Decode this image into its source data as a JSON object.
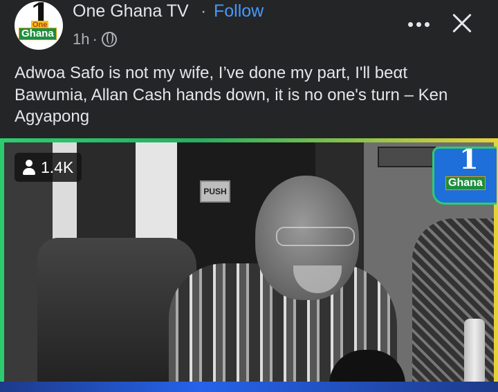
{
  "header": {
    "page_name": "One Ghana TV",
    "separator": "·",
    "follow_label": "Follow",
    "time": "1h",
    "meta_dot": "·",
    "avatar_logo": {
      "number": "1",
      "word1": "One",
      "word2": "Ghana"
    },
    "more_icon": "more-dots-icon",
    "close_icon": "close-icon",
    "privacy_icon": "globe-icon"
  },
  "post": {
    "caption": "Adwoa Safo is not my wife, I’ve done my part, I'll beαt Bawumia, Allan Cash hands down, it is no one's turn – Ken Agyapong"
  },
  "video": {
    "views": "1.4K",
    "views_icon": "person-icon",
    "sign_text": "PUSH",
    "watermark": {
      "number": "1",
      "word": "Ghana"
    }
  },
  "colors": {
    "background": "#242526",
    "text": "#e4e6eb",
    "secondary_text": "#b0b3b8",
    "link": "#4599ff",
    "video_border": "#2ecc71"
  }
}
